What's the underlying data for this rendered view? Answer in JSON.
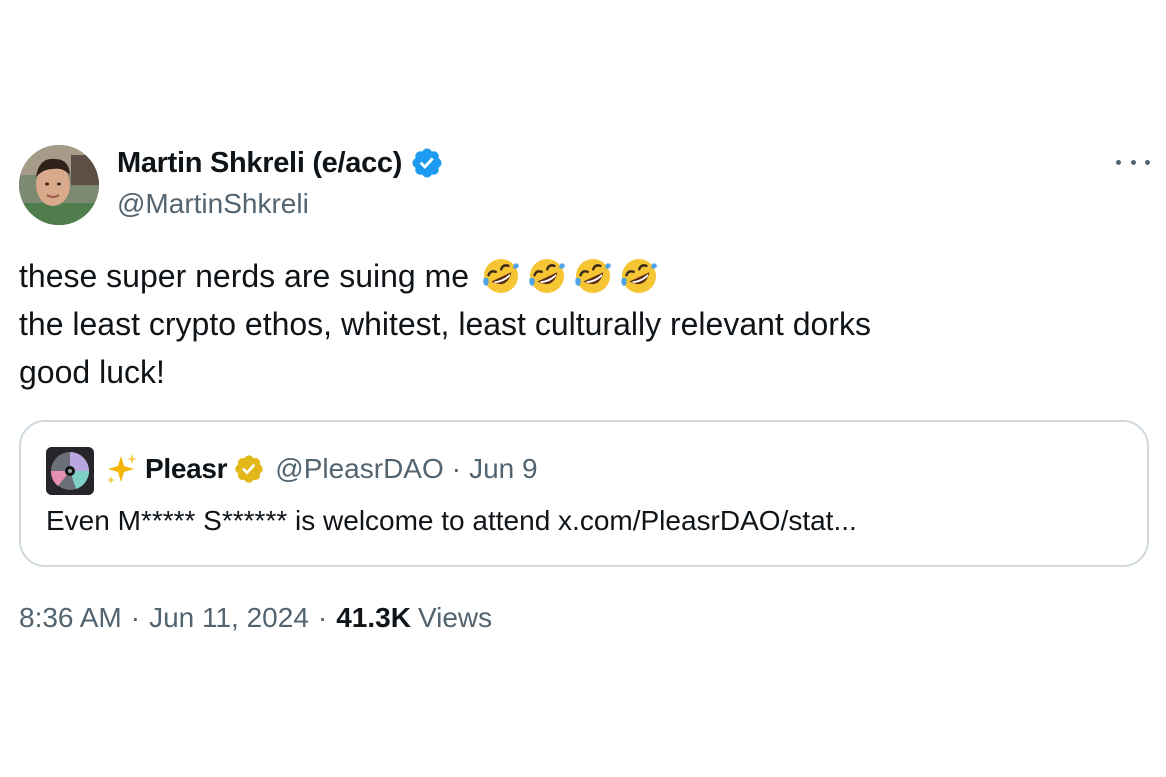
{
  "author": {
    "name": "Martin Shkreli (e/acc)",
    "handle": "@MartinShkreli",
    "verified_color": "#1d9bf0"
  },
  "more_icon": "more-horizontal-icon",
  "tweet": {
    "line1": "these super nerds are suing me",
    "line1_emoji": "rolling-on-floor-laughing",
    "line1_emoji_count": 4,
    "line2": "the least crypto ethos, whitest, least culturally relevant dorks",
    "line3": "good luck!"
  },
  "quoted": {
    "name": "Pleasr",
    "handle": "@PleasrDAO",
    "separator": "·",
    "date": "Jun 9",
    "text": "Even M***** S****** is welcome to attend x.com/PleasrDAO/stat...",
    "badge_color": "#e2b719"
  },
  "meta": {
    "time": "8:36 AM",
    "separator": "·",
    "date": "Jun 11, 2024",
    "views_count": "41.3K",
    "views_label": "Views"
  },
  "colors": {
    "text": "#0f1419",
    "secondary": "#536471",
    "border": "#cfd9de"
  }
}
